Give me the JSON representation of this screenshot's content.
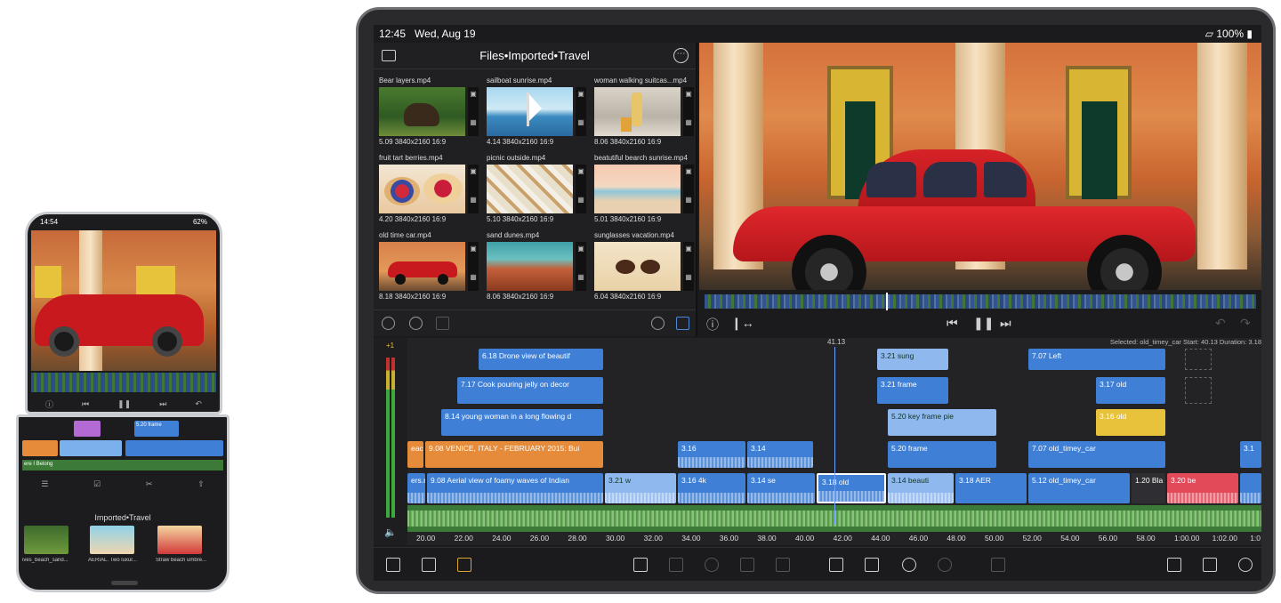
{
  "phone": {
    "status_time": "14:54",
    "status_battery": "62%",
    "clip_label": "5.20 frame",
    "track_label": "ere I Belong",
    "library_title": "Imported•Travel",
    "thumbs": [
      {
        "label": "ives_beach_sand..."
      },
      {
        "label": "AERIAL. Two luxur..."
      },
      {
        "label": "Straw beach umbre..."
      }
    ]
  },
  "tablet": {
    "status_time": "12:45",
    "status_date": "Wed, Aug 19",
    "status_battery": "100%",
    "browser": {
      "title": "Files•Imported•Travel",
      "clips": [
        {
          "name": "Bear layers.mp4",
          "meta": "5.09 3840x2160  16:9"
        },
        {
          "name": "sailboat sunrise.mp4",
          "meta": "4.14 3840x2160  16:9"
        },
        {
          "name": "woman walking suitcas...mp4",
          "meta": "8.06 3840x2160  16:9"
        },
        {
          "name": "fruit tart berries.mp4",
          "meta": "4.20 3840x2160  16:9"
        },
        {
          "name": "picnic outside.mp4",
          "meta": "5.10 3840x2160  16:9"
        },
        {
          "name": "beatutiful bearch sunrise.mp4",
          "meta": "5.01 3840x2160  16:9"
        },
        {
          "name": "old time car.mp4",
          "meta": "8.18 3840x2160  16:9"
        },
        {
          "name": "sand dunes.mp4",
          "meta": "8.06 3840x2160  16:9"
        },
        {
          "name": "sunglasses vacation.mp4",
          "meta": "6.04 3840x2160  16:9"
        }
      ]
    },
    "timeline": {
      "track_count": "+1",
      "playhead_time": "41.13",
      "selection_info": "Selected: old_timey_car Start: 40.13 Duration: 3.18",
      "clips": [
        {
          "label": "6.18 Drone view of beautif"
        },
        {
          "label": "7.17 Cook pouring jelly on decor"
        },
        {
          "label": "8.14 young woman in a long flowing d"
        },
        {
          "label": "9.08 VENICE, ITALY - FEBRUARY 2015: Bui"
        },
        {
          "label": "9.08 Aerial view of foamy waves of Indian"
        },
        {
          "label": "eacl"
        },
        {
          "label": "ers.m"
        },
        {
          "label": "3.16"
        },
        {
          "label": "3.14"
        },
        {
          "label": "3.21 w"
        },
        {
          "label": "3.16 4k"
        },
        {
          "label": "3.14 se"
        },
        {
          "label": "3.18 old"
        },
        {
          "label": "3.21 sung"
        },
        {
          "label": "3.21 frame"
        },
        {
          "label": "5.20 key frame pie"
        },
        {
          "label": "5.20 frame"
        },
        {
          "label": "3.14 beauti"
        },
        {
          "label": "3.18 AER"
        },
        {
          "label": "7.07 Left"
        },
        {
          "label": "3.17 old"
        },
        {
          "label": "3.16 old"
        },
        {
          "label": "7.07 old_timey_car"
        },
        {
          "label": "5.12 old_timey_car"
        },
        {
          "label": "1.20 Bla"
        },
        {
          "label": "3.20 be"
        },
        {
          "label": "3.1"
        }
      ],
      "ruler": [
        "20.00",
        "22.00",
        "24.00",
        "26.00",
        "28.00",
        "30.00",
        "32.00",
        "34.00",
        "36.00",
        "38.00",
        "40.00",
        "42.00",
        "44.00",
        "46.00",
        "48.00",
        "50.00",
        "52.00",
        "54.00",
        "56.00",
        "58.00",
        "1:00.00",
        "1:02.00",
        "1:0"
      ]
    }
  },
  "icons": {
    "folder": "folder-icon",
    "more": "more-icon",
    "check": "check-icon",
    "record": "record-icon",
    "trash": "trash-icon",
    "search": "search-icon",
    "info": "info-icon",
    "split": "split-icon",
    "prev": "skip-back-icon",
    "pause": "pause-icon",
    "next": "skip-forward-icon",
    "undo": "undo-icon",
    "redo": "redo-icon"
  }
}
